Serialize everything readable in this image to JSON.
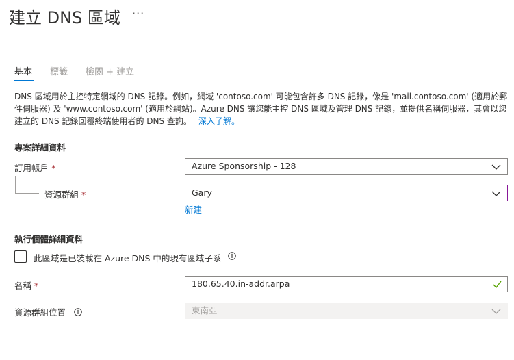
{
  "header": {
    "title": "建立 DNS 區域",
    "more": "···"
  },
  "tabs": [
    {
      "label": "基本"
    },
    {
      "label": "標籤"
    },
    {
      "label": "檢閱 + 建立"
    }
  ],
  "description": {
    "text": "DNS 區域用於主控特定網域的 DNS 記錄。例如，網域 'contoso.com' 可能包含許多 DNS 記錄，像是 'mail.contoso.com' (適用於郵件伺服器) 及 'www.contoso.com' (適用於網站)。Azure DNS 讓您能主控 DNS 區域及管理 DNS 記錄，並提供名稱伺服器，其會以您建立的 DNS 記錄回覆終端使用者的 DNS 查詢。",
    "link": "深入了解。"
  },
  "project": {
    "heading": "專案詳細資料",
    "subscription_label": "訂用帳戶",
    "subscription_value": "Azure Sponsorship - 128",
    "resource_group_label": "資源群組",
    "resource_group_value": "Gary",
    "new_link": "新建",
    "required": "*"
  },
  "instance": {
    "heading": "執行個體詳細資料",
    "child_zone_label": "此區域是已裝載在 Azure DNS 中的現有區域子系",
    "name_label": "名稱",
    "name_value": "180.65.40.in-addr.arpa",
    "location_label": "資源群組位置",
    "location_value": "東南亞",
    "required": "*"
  },
  "colors": {
    "accent": "#0078d4",
    "focus_border": "#881798",
    "required": "#a4262c",
    "valid_check": "#57a300"
  },
  "icons": [
    "more-icon",
    "chevron-down-icon",
    "info-icon",
    "checkmark-icon"
  ]
}
